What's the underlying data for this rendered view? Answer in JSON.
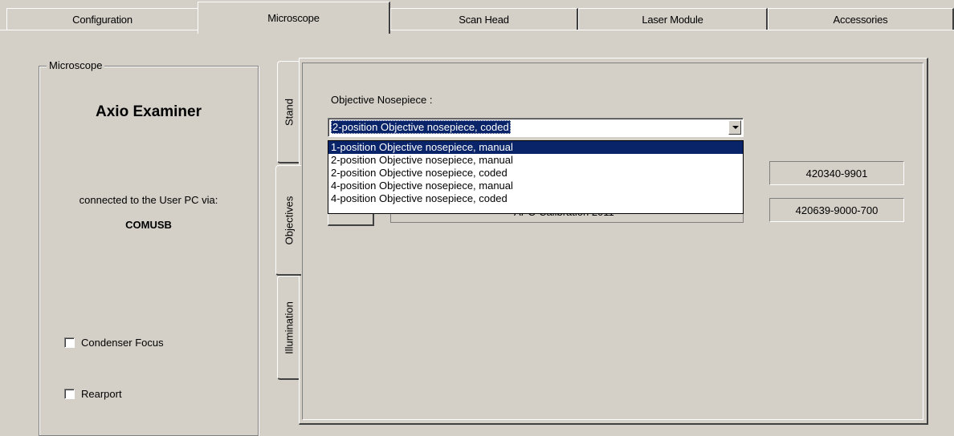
{
  "top_tabs": [
    {
      "label": "Configuration",
      "active": false
    },
    {
      "label": "Microscope",
      "active": true
    },
    {
      "label": "Scan Head",
      "active": false
    },
    {
      "label": "Laser Module",
      "active": false
    },
    {
      "label": "Accessories",
      "active": false
    }
  ],
  "microscope_group": {
    "legend": "Microscope",
    "model": "Axio Examiner",
    "connected_label": "connected to the User PC via:",
    "port": "COMUSB",
    "checkboxes": [
      {
        "label": "Condenser Focus",
        "checked": false
      },
      {
        "label": "Rearport",
        "checked": false
      }
    ]
  },
  "side_tabs": [
    {
      "label": "Stand",
      "active": false
    },
    {
      "label": "Objectives",
      "active": true
    },
    {
      "label": "Illumination",
      "active": false
    }
  ],
  "objectives": {
    "nosepiece_label": "Objective Nosepiece :",
    "selected": "2-position Objective nosepiece, coded",
    "options": [
      "1-position Objective nosepiece, manual",
      "2-position Objective nosepiece, manual",
      "2-position Objective nosepiece, coded",
      "4-position Objective nosepiece, manual",
      "4-position Objective nosepiece, coded"
    ],
    "highlighted_option": "1-position Objective nosepiece, manual",
    "obscured_text": "APO Calibration 2011",
    "part_numbers": [
      "420340-9901",
      "420639-9000-700"
    ]
  },
  "colors": {
    "background": "#d4d0c8",
    "selection": "#0a246a"
  }
}
